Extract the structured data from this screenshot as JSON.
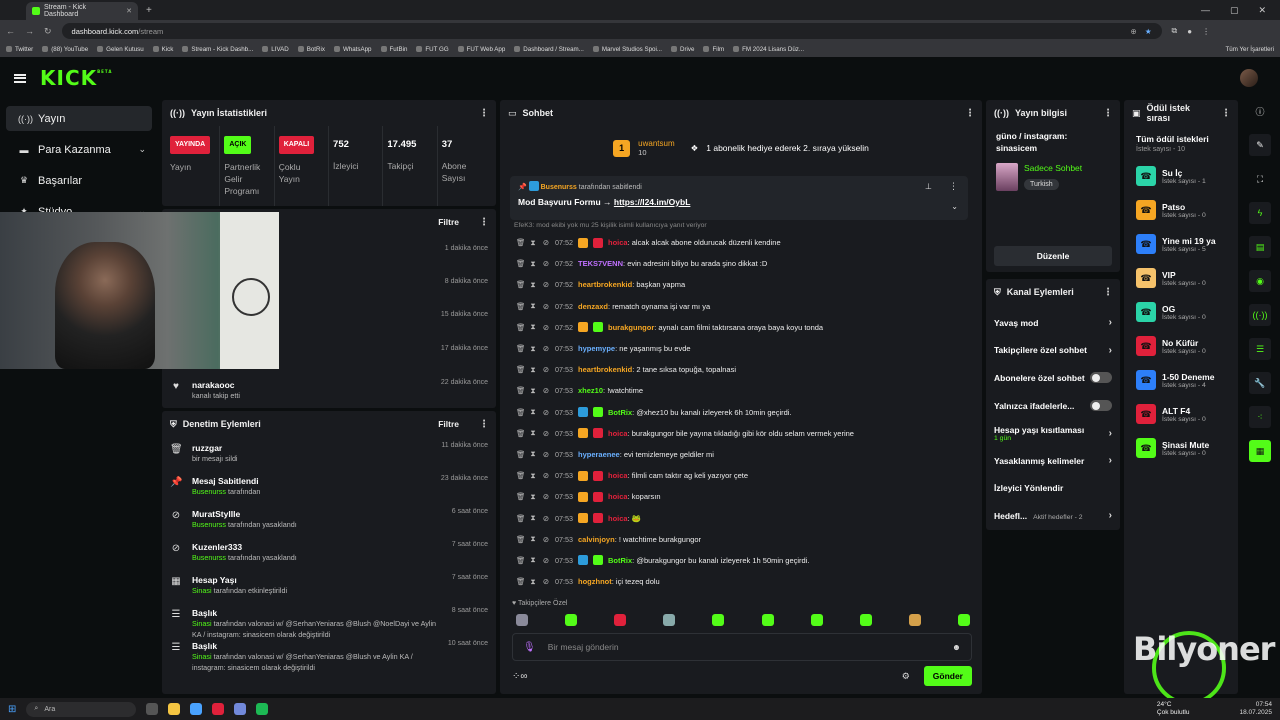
{
  "browser": {
    "tab_title": "Stream - Kick Dashboard",
    "url_host": "dashboard.kick.com",
    "url_path": "/stream",
    "bookmarks": [
      "Twitter",
      "(88) YouTube",
      "Gelen Kutusu",
      "Kick",
      "Stream - Kick Dashb...",
      "LIVAD",
      "BotRix",
      "WhatsApp",
      "FutBin",
      "FUT GG",
      "FUT Web App",
      "Dashboard / Stream...",
      "Marvel Studios Spoi...",
      "Drive",
      "Film",
      "FM 2024 Lisans Düz..."
    ],
    "bookmarks_right": "Tüm Yer İşaretleri"
  },
  "logo": "KICK",
  "logo_beta": "BETA",
  "nav": [
    "Yayın",
    "Para Kazanma",
    "Başarılar",
    "Stüdyo"
  ],
  "stats": {
    "title": "Yayın İstatistikleri",
    "items": [
      {
        "badge": "YAYINDA",
        "label": "Yayın"
      },
      {
        "badge": "AÇIK",
        "label": "Partnerlik Gelir Programı"
      },
      {
        "badge": "KAPALI",
        "label": "Çoklu Yayın"
      },
      {
        "value": "752",
        "label": "İzleyici"
      },
      {
        "value": "17.495",
        "label": "Takipçi"
      },
      {
        "value": "37",
        "label": "Abone Sayısı"
      }
    ]
  },
  "activity": {
    "filter": "Filtre",
    "times": [
      "1 dakika önce",
      "8 dakika önce",
      "15 dakika önce",
      "17 dakika önce"
    ],
    "last": {
      "name": "narakaooc",
      "sub": "kanalı takip etti",
      "time": "22 dakika önce"
    }
  },
  "mod": {
    "title": "Denetim Eylemleri",
    "filter": "Filtre",
    "items": [
      {
        "title": "ruzzgar",
        "sub_user": "",
        "sub": "bir mesajı sildi",
        "time": "11 dakika önce"
      },
      {
        "title": "Mesaj Sabitlendi",
        "sub_user": "Busenurss",
        "sub": "tarafından",
        "time": "23 dakika önce"
      },
      {
        "title": "MuratStylIle",
        "sub_user": "Busenurss",
        "sub": "tarafından yasaklandı",
        "time": "6 saat önce"
      },
      {
        "title": "Kuzenler333",
        "sub_user": "Busenurss",
        "sub": "tarafından yasaklandı",
        "time": "7 saat önce"
      },
      {
        "title": "Hesap Yaşı",
        "sub_user": "Sinasi",
        "sub": "tarafından etkinleştirildi",
        "time": "7 saat önce"
      },
      {
        "title": "Başlık",
        "sub_user": "Sinasi",
        "sub": "tarafından valonasi w/ @SerhanYeniaras @Blush @NoelDayi ve Aylin KA / instagram: sinasicem olarak değiştirildi",
        "time": "8 saat önce"
      },
      {
        "title": "Başlık",
        "sub_user": "Sinasi",
        "sub": "tarafından valonasi w/ @SerhanYeniaras @Blush ve Aylin KA / instagram: sinasicem olarak değiştirildi",
        "time": "10 saat önce"
      }
    ]
  },
  "chat": {
    "title": "Sohbet",
    "gift_user": "uwantsum",
    "gift_count": "10",
    "gift_rank": "1",
    "gift_text": "1 abonelik hediye ederek 2. sıraya yükselin",
    "pinned_by": "Busenurss",
    "pinned_suffix": "tarafından sabitlendi",
    "pinned_msg": "Mod Başvuru Formu → ",
    "pinned_link": "https://l24.im/OybL",
    "reply_hint": "EfeK3: mod ekibi yok mu 25 kişilik isimli kullanıcıya yanıt veriyor",
    "messages": [
      {
        "time": "07:52",
        "user": "hoica",
        "color": "#e0213b",
        "badges": [
          "#f5a623",
          "#e0213b"
        ],
        "text": "alcak alcak abone oldurucak düzenli kendine"
      },
      {
        "time": "07:52",
        "user": "TEKS7VENN",
        "color": "#c070ff",
        "badges": [],
        "text": "evin adresini biliyo bu arada şino dikkat :D"
      },
      {
        "time": "07:52",
        "user": "heartbrokenkid",
        "color": "#f5a623",
        "badges": [],
        "text": "başkan yapma"
      },
      {
        "time": "07:52",
        "user": "denzaxd",
        "color": "#f5a623",
        "badges": [],
        "text": "rematch oynama işi var mı ya"
      },
      {
        "time": "07:52",
        "user": "burakgungor",
        "color": "#f5a623",
        "badges": [
          "#f5a623",
          "#53fc18"
        ],
        "text": "aynalı cam filmi taktırsana oraya baya koyu tonda"
      },
      {
        "time": "07:53",
        "user": "hypemype",
        "color": "#6ab0ff",
        "badges": [],
        "text": "ne yaşanmış bu evde"
      },
      {
        "time": "07:53",
        "user": "heartbrokenkid",
        "color": "#f5a623",
        "badges": [],
        "text": "2 tane sıksa topuğa, topalnasi"
      },
      {
        "time": "07:53",
        "user": "xhez10",
        "color": "#53fc18",
        "badges": [],
        "text": "!watchtime"
      },
      {
        "time": "07:53",
        "user": "BotRix",
        "color": "#53fc18",
        "badges": [
          "#2d9cdb",
          "#53fc18"
        ],
        "text": "@xhez10 bu kanalı izleyerek 6h 10min geçirdi."
      },
      {
        "time": "07:53",
        "user": "hoica",
        "color": "#e0213b",
        "badges": [
          "#f5a623",
          "#e0213b"
        ],
        "text": "burakgungor bile yayına tıkladığı gibi kör oldu selam vermek yerine"
      },
      {
        "time": "07:53",
        "user": "hyperaenee",
        "color": "#6ab0ff",
        "badges": [],
        "text": "evi temizlemeye geldiler mi"
      },
      {
        "time": "07:53",
        "user": "hoica",
        "color": "#e0213b",
        "badges": [
          "#f5a623",
          "#e0213b"
        ],
        "text": "filmli cam taktır ag keli yazıyor çete"
      },
      {
        "time": "07:53",
        "user": "hoica",
        "color": "#e0213b",
        "badges": [
          "#f5a623",
          "#e0213b"
        ],
        "text": "koparsın"
      },
      {
        "time": "07:53",
        "user": "hoica",
        "color": "#e0213b",
        "badges": [
          "#f5a623",
          "#e0213b"
        ],
        "text": "🐸"
      },
      {
        "time": "07:53",
        "user": "calvinjoyn",
        "color": "#f5a623",
        "badges": [],
        "text": "! watchtime burakgungor"
      },
      {
        "time": "07:53",
        "user": "BotRix",
        "color": "#53fc18",
        "badges": [
          "#2d9cdb",
          "#53fc18"
        ],
        "text": "@burakgungor bu kanalı izleyerek 1h 50min geçirdi."
      },
      {
        "time": "07:53",
        "user": "hogzhnot",
        "color": "#f5a623",
        "badges": [],
        "text": "içi tezeq dolu"
      }
    ],
    "followers_only": "Takipçilere Özel",
    "placeholder": "Bir mesaj gönderin",
    "send": "Gönder"
  },
  "stream_info": {
    "title": "Yayın bilgisi",
    "stream_title": "güno / instagram: sinasicem",
    "category": "Sadece Sohbet",
    "tag": "Turkish",
    "edit": "Düzenle"
  },
  "channel_actions": {
    "title": "Kanal Eylemleri",
    "items": [
      {
        "label": "Yavaş mod",
        "type": "chevron"
      },
      {
        "label": "Takipçilere özel sohbet",
        "type": "chevron"
      },
      {
        "label": "Abonelere özel sohbet",
        "type": "toggle"
      },
      {
        "label": "Yalnızca ifadelerle...",
        "type": "toggle"
      },
      {
        "label": "Hesap yaşı kısıtlaması",
        "sub": "1 gün",
        "type": "chevron"
      },
      {
        "label": "Yasaklanmış kelimeler",
        "type": "chevron"
      },
      {
        "label": "İzleyici Yönlendir",
        "type": "none"
      },
      {
        "label": "Hedefl...",
        "sub2": "Aktif hedefler - 2",
        "type": "chevron"
      }
    ]
  },
  "rewards": {
    "title": "Ödül istek sırası",
    "all": "Tüm ödül istekleri",
    "all_count": "İstek sayısı - 10",
    "items": [
      {
        "name": "Su İç",
        "count": "İstek sayısı - 1",
        "color": "#2bd4a8"
      },
      {
        "name": "Patso",
        "count": "İstek sayısı - 0",
        "color": "#f5a623"
      },
      {
        "name": "Yine mi 19 ya",
        "count": "İstek sayısı - 5",
        "color": "#2d7ff9"
      },
      {
        "name": "VIP",
        "count": "İstek sayısı - 0",
        "color": "#f5c26b"
      },
      {
        "name": "OG",
        "count": "İstek sayısı - 0",
        "color": "#2bd4a8"
      },
      {
        "name": "No Küfür",
        "count": "İstek sayısı - 0",
        "color": "#e0213b"
      },
      {
        "name": "1-50 Deneme",
        "count": "İstek sayısı - 4",
        "color": "#2d7ff9"
      },
      {
        "name": "ALT F4",
        "count": "İstek sayısı - 0",
        "color": "#e0213b"
      },
      {
        "name": "Şinasi Mute",
        "count": "İstek sayısı - 0",
        "color": "#53fc18"
      }
    ]
  },
  "taskbar": {
    "search": "Ara",
    "temp": "24°C",
    "weather": "Çok bulutlu",
    "time": "07:54",
    "date": "18.07.2025"
  },
  "watermark": "Bilyoner"
}
